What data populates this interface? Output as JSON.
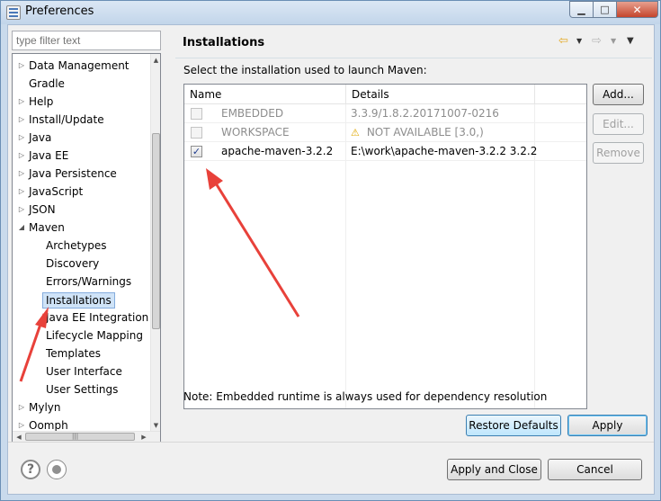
{
  "window": {
    "title": "Preferences"
  },
  "filter": {
    "placeholder": "type filter text"
  },
  "tree": [
    {
      "label": "Data Management",
      "level": 0,
      "expandable": true,
      "expanded": false
    },
    {
      "label": "Gradle",
      "level": 0,
      "expandable": false
    },
    {
      "label": "Help",
      "level": 0,
      "expandable": true,
      "expanded": false
    },
    {
      "label": "Install/Update",
      "level": 0,
      "expandable": true,
      "expanded": false
    },
    {
      "label": "Java",
      "level": 0,
      "expandable": true,
      "expanded": false
    },
    {
      "label": "Java EE",
      "level": 0,
      "expandable": true,
      "expanded": false
    },
    {
      "label": "Java Persistence",
      "level": 0,
      "expandable": true,
      "expanded": false
    },
    {
      "label": "JavaScript",
      "level": 0,
      "expandable": true,
      "expanded": false
    },
    {
      "label": "JSON",
      "level": 0,
      "expandable": true,
      "expanded": false
    },
    {
      "label": "Maven",
      "level": 0,
      "expandable": true,
      "expanded": true
    },
    {
      "label": "Archetypes",
      "level": 1
    },
    {
      "label": "Discovery",
      "level": 1
    },
    {
      "label": "Errors/Warnings",
      "level": 1
    },
    {
      "label": "Installations",
      "level": 1,
      "selected": true
    },
    {
      "label": "Java EE Integration",
      "level": 1
    },
    {
      "label": "Lifecycle Mapping",
      "level": 1
    },
    {
      "label": "Templates",
      "level": 1
    },
    {
      "label": "User Interface",
      "level": 1
    },
    {
      "label": "User Settings",
      "level": 1
    },
    {
      "label": "Mylyn",
      "level": 0,
      "expandable": true,
      "expanded": false
    },
    {
      "label": "Oomph",
      "level": 0,
      "expandable": true,
      "expanded": false
    }
  ],
  "page": {
    "title": "Installations",
    "description": "Select the installation used to launch Maven:",
    "note": "Note: Embedded runtime is always used for dependency resolution"
  },
  "table": {
    "columns": [
      "Name",
      "Details"
    ],
    "rows": [
      {
        "checked": false,
        "enabled": false,
        "name": "EMBEDDED",
        "details": "3.3.9/1.8.2.20171007-0216",
        "warning": false
      },
      {
        "checked": false,
        "enabled": false,
        "name": "WORKSPACE",
        "details": "NOT AVAILABLE [3.0,)",
        "warning": true
      },
      {
        "checked": true,
        "enabled": true,
        "name": "apache-maven-3.2.2",
        "details": "E:\\work\\apache-maven-3.2.2 3.2.2",
        "warning": false
      }
    ]
  },
  "buttons": {
    "add": "Add...",
    "edit": "Edit...",
    "remove": "Remove",
    "restore_defaults": "Restore Defaults",
    "apply": "Apply",
    "apply_and_close": "Apply and Close",
    "cancel": "Cancel"
  },
  "icons": {
    "app": "preferences-icon",
    "back": "back-arrow-icon",
    "forward": "forward-arrow-icon",
    "view_menu": "view-menu-icon",
    "help": "help-icon",
    "import": "import-export-icon"
  },
  "colors": {
    "selection": "#cfe3f7",
    "annotation_arrow": "#e8413a",
    "back_arrow": "#e4a820"
  }
}
